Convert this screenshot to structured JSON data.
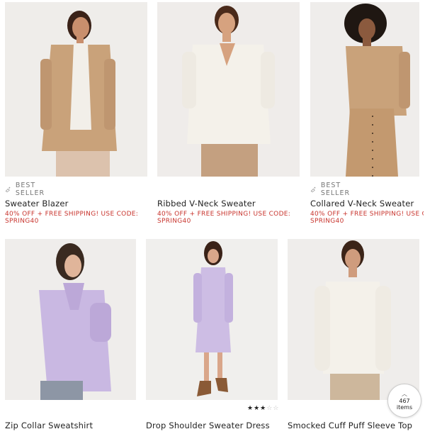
{
  "products": [
    {
      "name": "Sweater Blazer",
      "badge": "BEST SELLER",
      "promo_line1": "40% OFF + FREE SHIPPING! USE CODE:",
      "promo_line2": "SPRING40",
      "image": "model in camel sweater blazer"
    },
    {
      "name": "Ribbed V-Neck Sweater",
      "badge": "",
      "promo_line1": "40% OFF + FREE SHIPPING! USE CODE:",
      "promo_line2": "SPRING40",
      "image": "model in ivory ribbed v-neck sweater"
    },
    {
      "name": "Collared V-Neck Sweater",
      "badge": "BEST SELLER",
      "promo_line1": "40% OFF + FREE SHIPPING! USE CO",
      "promo_line2": "SPRING40",
      "image": "model in camel collared v-neck sweater"
    },
    {
      "name": "Zip Collar Sweatshirt",
      "badge": "",
      "promo_line1": "",
      "promo_line2": "",
      "image": "model in lavender zip collar sweatshirt"
    },
    {
      "name": "Drop Shoulder Sweater Dress",
      "badge": "",
      "promo_line1": "",
      "promo_line2": "",
      "rating": 3,
      "rating_max": 5,
      "image": "model in lavender sweater dress"
    },
    {
      "name": "Smocked Cuff Puff Sleeve Top",
      "badge": "",
      "promo_line1": "",
      "promo_line2": "",
      "image": "model in ivory puff sleeve top"
    }
  ],
  "scroll_indicator": {
    "count": "467",
    "unit": "items",
    "icon": "chevron-up-icon"
  },
  "colors": {
    "promo": "#c8342d",
    "photo_bg": "#f1f0ee",
    "camel": "#c9a27a",
    "ivory": "#f4f1ea",
    "lavender": "#c9b8e2"
  }
}
